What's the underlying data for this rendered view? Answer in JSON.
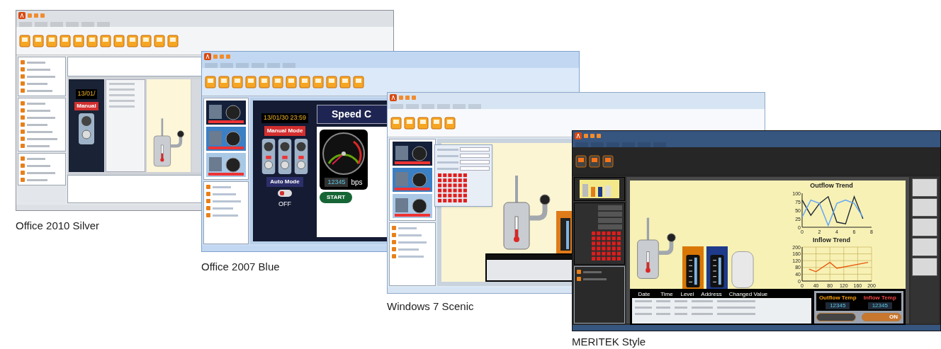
{
  "windows": [
    {
      "kind": "silver",
      "caption": "Office 2010 Silver",
      "hmi": {
        "date": "13/01/",
        "manual": "Manual"
      }
    },
    {
      "kind": "blue",
      "caption": "Office 2007 Blue",
      "hmi": {
        "date": "13/01/30 23:59",
        "manual": "Manual Mode",
        "auto": "Auto Mode",
        "switch_state": "OFF",
        "switch_on": false,
        "banner": "Speed C",
        "reading": "12345",
        "unit": "bps",
        "start": "START"
      }
    },
    {
      "kind": "scenic",
      "caption": "Windows 7 Scenic"
    },
    {
      "kind": "meritek",
      "caption": "MERITEK Style",
      "gauges": [
        {
          "color": "#d97706"
        },
        {
          "color": "#1e3a8a"
        }
      ],
      "charts": [
        {
          "chart_data": {
            "type": "line",
            "title": "Outflow Trend",
            "grid": false,
            "xlim": [
              0,
              8
            ],
            "ylim": [
              0,
              100
            ],
            "xticks": [
              0,
              2,
              4,
              6,
              8
            ],
            "yticks": [
              0,
              25,
              50,
              75,
              100
            ],
            "x": [
              0,
              1,
              2,
              3,
              4,
              5,
              6,
              7
            ],
            "series": [
              {
                "color": "#1f2937",
                "values": [
                  80,
                  35,
                  70,
                  90,
                  15,
                  10,
                  90,
                  25
                ]
              },
              {
                "color": "#60a5fa",
                "values": [
                  30,
                  80,
                  70,
                  5,
                  70,
                  80,
                  70,
                  30
                ]
              }
            ]
          }
        },
        {
          "chart_data": {
            "type": "line",
            "title": "Inflow Trend",
            "grid": true,
            "xlim": [
              0,
              200
            ],
            "ylim": [
              0,
              200
            ],
            "xticks": [
              0,
              40,
              80,
              120,
              160,
              200
            ],
            "yticks": [
              0,
              40,
              80,
              120,
              160,
              200
            ],
            "x": [
              20,
              40,
              80,
              100,
              190
            ],
            "series": [
              {
                "color": "#ea580c",
                "values": [
                  70,
                  55,
                  110,
                  75,
                  110
                ]
              }
            ]
          }
        }
      ],
      "table": {
        "columns": [
          "Date",
          "Time",
          "Level",
          "Address",
          "Changed Value"
        ]
      },
      "temps": [
        {
          "label": "Outflow Temp",
          "value": "12345"
        },
        {
          "label": "Inflow Temp",
          "value": "12345"
        }
      ],
      "switches": [
        {
          "on": false
        },
        {
          "on": true,
          "label": "ON"
        }
      ]
    }
  ]
}
